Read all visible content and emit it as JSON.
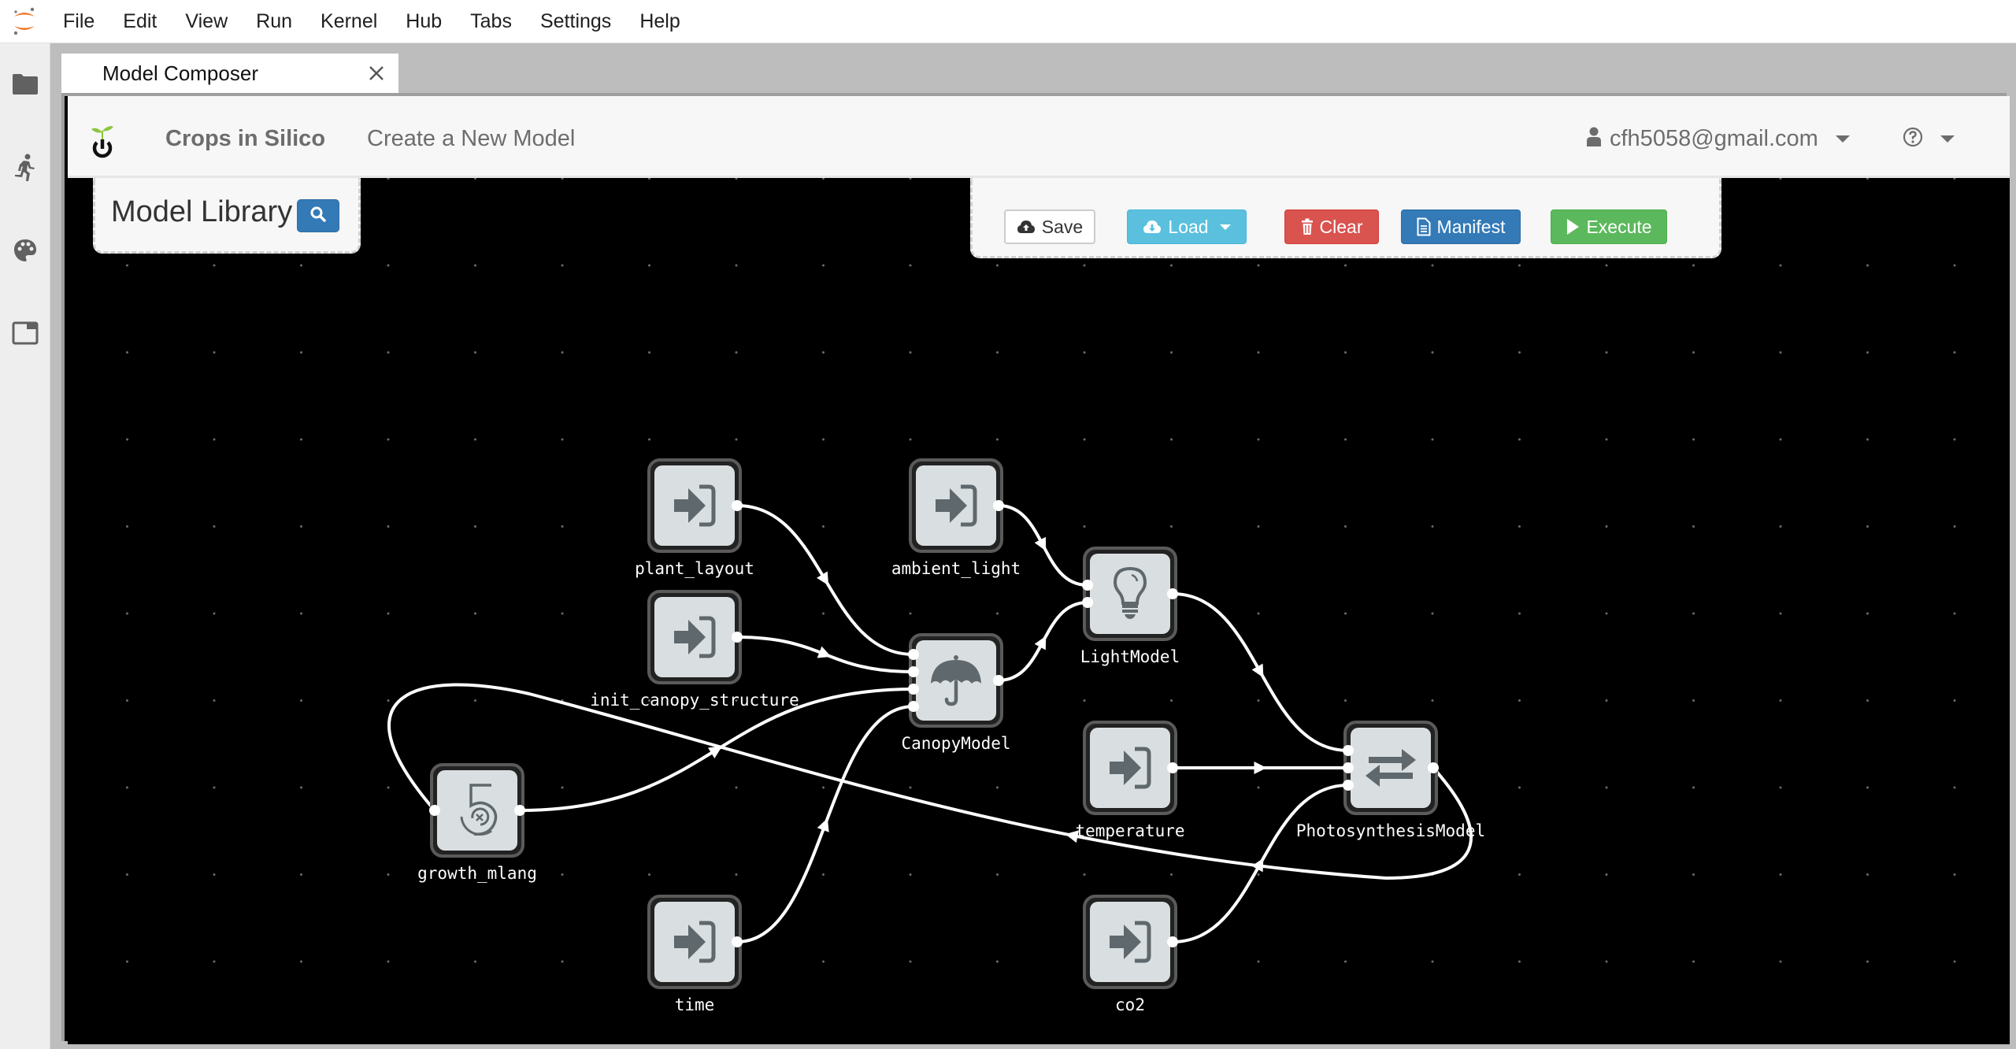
{
  "menubar": {
    "items": [
      "File",
      "Edit",
      "View",
      "Run",
      "Kernel",
      "Hub",
      "Tabs",
      "Settings",
      "Help"
    ]
  },
  "sidebar": {
    "icons": [
      "folder-icon",
      "running-icon",
      "palette-icon",
      "tabs-icon"
    ]
  },
  "tabs": [
    {
      "label": "Model Composer",
      "active": true
    }
  ],
  "header": {
    "brand": "Crops in Silico",
    "nav_create": "Create a New Model",
    "user_email": "cfh5058@gmail.com"
  },
  "library": {
    "title": "Model Library"
  },
  "toolbar": {
    "save_label": "Save",
    "load_label": "Load",
    "clear_label": "Clear",
    "manifest_label": "Manifest",
    "execute_label": "Execute"
  },
  "colors": {
    "canvas_bg": "#000000",
    "node_fill": "#d9dfe1",
    "node_icon": "#5f686c",
    "edge": "#ffffff",
    "save": "#ffffff",
    "load": "#5bc0de",
    "clear": "#d9534f",
    "manifest": "#337ab7",
    "execute": "#5cb85c"
  },
  "graph": {
    "nodes": [
      {
        "id": "plant_layout",
        "label": "plant_layout",
        "icon": "input-icon",
        "inputs": 0,
        "outputs": 1
      },
      {
        "id": "ambient_light",
        "label": "ambient_light",
        "icon": "input-icon",
        "inputs": 0,
        "outputs": 1
      },
      {
        "id": "init_canopy_structure",
        "label": "init_canopy_structure",
        "icon": "input-icon",
        "inputs": 0,
        "outputs": 1
      },
      {
        "id": "CanopyModel",
        "label": "CanopyModel",
        "icon": "umbrella-icon",
        "inputs": 4,
        "outputs": 1
      },
      {
        "id": "LightModel",
        "label": "LightModel",
        "icon": "lightbulb-icon",
        "inputs": 2,
        "outputs": 1
      },
      {
        "id": "growth_mlang",
        "label": "growth_mlang",
        "icon": "growth-icon",
        "inputs": 1,
        "outputs": 1
      },
      {
        "id": "temperature",
        "label": "temperature",
        "icon": "input-icon",
        "inputs": 0,
        "outputs": 1
      },
      {
        "id": "PhotosynthesisModel",
        "label": "PhotosynthesisModel",
        "icon": "exchange-icon",
        "inputs": 3,
        "outputs": 1
      },
      {
        "id": "time",
        "label": "time",
        "icon": "input-icon",
        "inputs": 0,
        "outputs": 1
      },
      {
        "id": "co2",
        "label": "co2",
        "icon": "input-icon",
        "inputs": 0,
        "outputs": 1
      }
    ],
    "edges": [
      {
        "from": "plant_layout",
        "to": "CanopyModel",
        "to_port": 0
      },
      {
        "from": "init_canopy_structure",
        "to": "CanopyModel",
        "to_port": 1
      },
      {
        "from": "growth_mlang",
        "to": "CanopyModel",
        "to_port": 2
      },
      {
        "from": "time",
        "to": "CanopyModel",
        "to_port": 3
      },
      {
        "from": "ambient_light",
        "to": "LightModel",
        "to_port": 0
      },
      {
        "from": "CanopyModel",
        "to": "LightModel",
        "to_port": 1
      },
      {
        "from": "LightModel",
        "to": "PhotosynthesisModel",
        "to_port": 0
      },
      {
        "from": "temperature",
        "to": "PhotosynthesisModel",
        "to_port": 1
      },
      {
        "from": "co2",
        "to": "PhotosynthesisModel",
        "to_port": 2
      },
      {
        "from": "PhotosynthesisModel",
        "to": "growth_mlang",
        "to_port": 0
      }
    ]
  }
}
